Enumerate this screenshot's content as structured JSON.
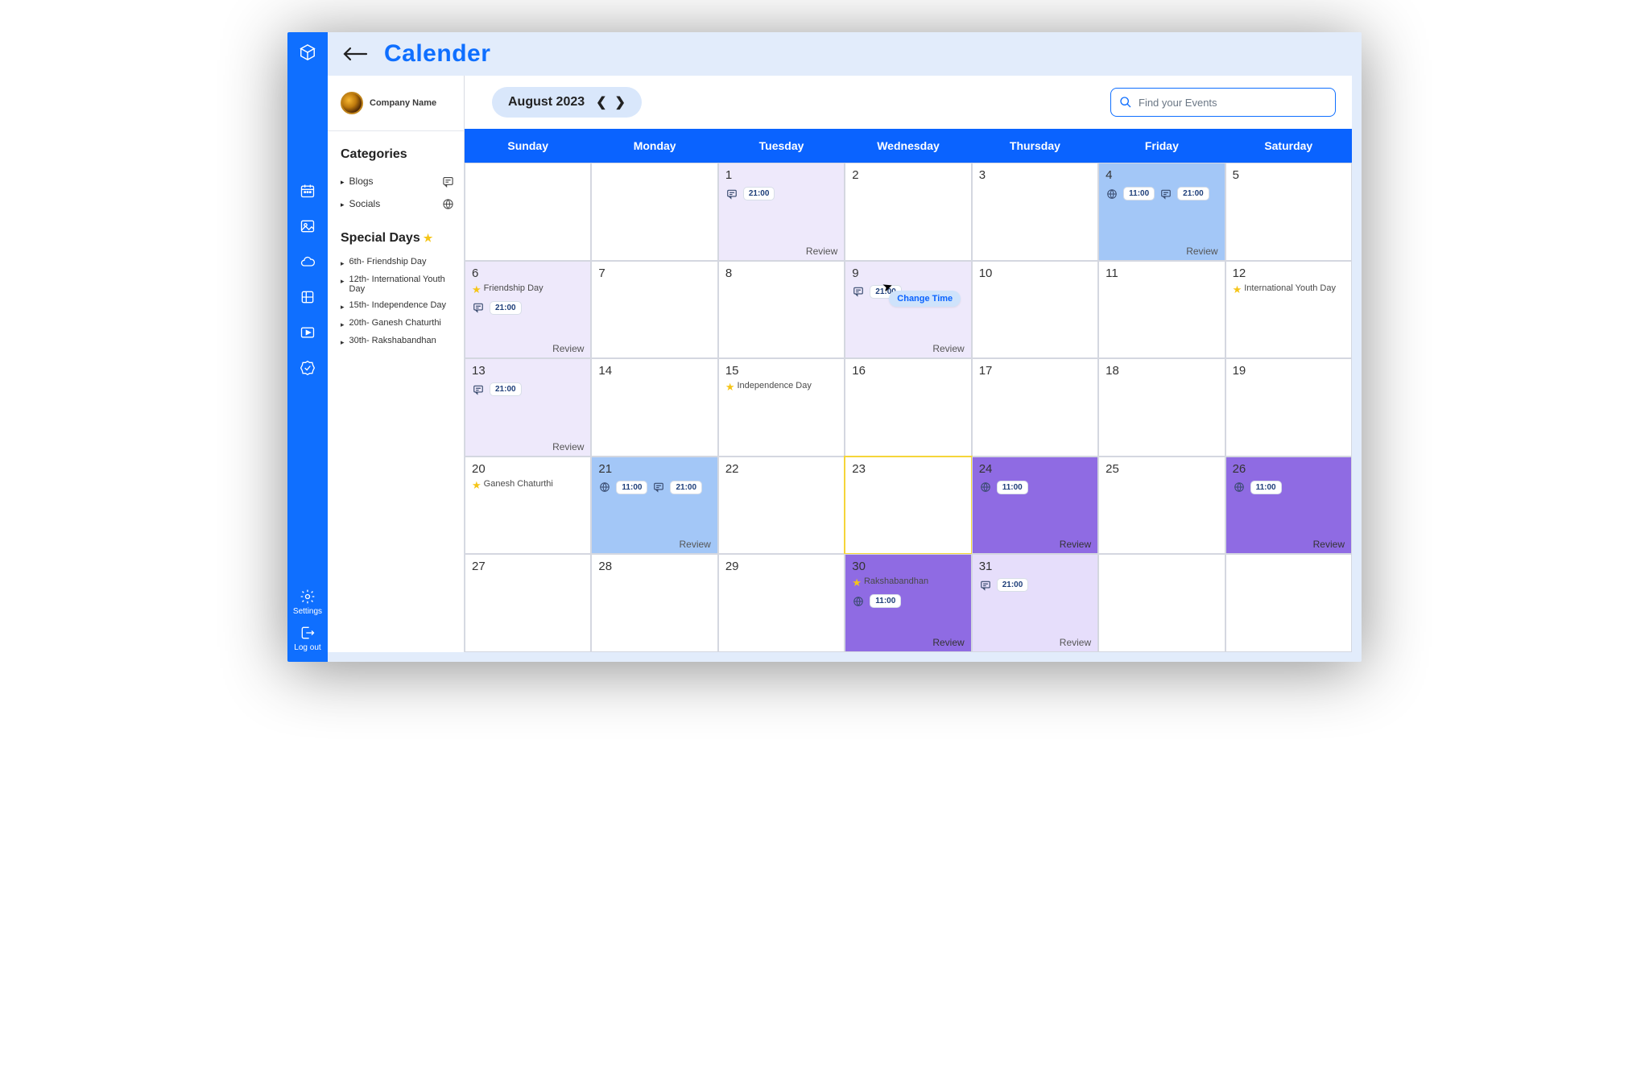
{
  "header": {
    "title": "Calender",
    "company": "Company Name",
    "month_label": "August 2023",
    "search_placeholder": "Find your Events"
  },
  "sidebar": {
    "settings_label": "Settings",
    "logout_label": "Log out"
  },
  "categories": {
    "title": "Categories",
    "items": [
      {
        "label": "Blogs",
        "icon": "blog"
      },
      {
        "label": "Socials",
        "icon": "social"
      }
    ]
  },
  "special_days": {
    "title": "Special Days",
    "items": [
      "6th- Friendship Day",
      "12th- International Youth Day",
      "15th- Independence Day",
      "20th- Ganesh Chaturthi",
      "30th- Rakshabandhan"
    ]
  },
  "days_of_week": [
    "Sunday",
    "Monday",
    "Tuesday",
    "Wednesday",
    "Thursday",
    "Friday",
    "Saturday"
  ],
  "tooltip": "Change Time",
  "review_label": "Review",
  "cells": {
    "d1": {
      "num": "1",
      "review": true,
      "chips": [
        {
          "icon": "blog",
          "time": "21:00"
        }
      ]
    },
    "d2": {
      "num": "2"
    },
    "d3": {
      "num": "3"
    },
    "d4": {
      "num": "4",
      "review": true,
      "chips": [
        {
          "icon": "social",
          "time": "11:00"
        },
        {
          "icon": "blog",
          "time": "21:00"
        }
      ]
    },
    "d5": {
      "num": "5"
    },
    "d6": {
      "num": "6",
      "review": true,
      "special": "Friendship Day",
      "chips": [
        {
          "icon": "blog",
          "time": "21:00"
        }
      ]
    },
    "d7": {
      "num": "7"
    },
    "d8": {
      "num": "8"
    },
    "d9": {
      "num": "9",
      "review": true,
      "chips": [
        {
          "icon": "blog",
          "time": "21:00"
        }
      ],
      "tooltip": true
    },
    "d10": {
      "num": "10"
    },
    "d11": {
      "num": "11"
    },
    "d12": {
      "num": "12",
      "special": "International Youth Day"
    },
    "d13": {
      "num": "13",
      "review": true,
      "chips": [
        {
          "icon": "blog",
          "time": "21:00"
        }
      ]
    },
    "d14": {
      "num": "14"
    },
    "d15": {
      "num": "15",
      "special": "Independence Day"
    },
    "d16": {
      "num": "16"
    },
    "d17": {
      "num": "17"
    },
    "d18": {
      "num": "18"
    },
    "d19": {
      "num": "19"
    },
    "d20": {
      "num": "20",
      "special": "Ganesh Chaturthi"
    },
    "d21": {
      "num": "21",
      "review": true,
      "chips": [
        {
          "icon": "social",
          "time": "11:00"
        },
        {
          "icon": "blog",
          "time": "21:00"
        }
      ]
    },
    "d22": {
      "num": "22"
    },
    "d23": {
      "num": "23"
    },
    "d24": {
      "num": "24",
      "review": true,
      "chips": [
        {
          "icon": "social",
          "time": "11:00"
        }
      ]
    },
    "d25": {
      "num": "25"
    },
    "d26": {
      "num": "26",
      "review": true,
      "chips": [
        {
          "icon": "social",
          "time": "11:00"
        }
      ]
    },
    "d27": {
      "num": "27"
    },
    "d28": {
      "num": "28"
    },
    "d29": {
      "num": "29"
    },
    "d30": {
      "num": "30",
      "review": true,
      "special": "Rakshabandhan",
      "chips": [
        {
          "icon": "social",
          "time": "11:00"
        }
      ]
    },
    "d31": {
      "num": "31",
      "review": true,
      "chips": [
        {
          "icon": "blog",
          "time": "21:00"
        }
      ]
    }
  }
}
